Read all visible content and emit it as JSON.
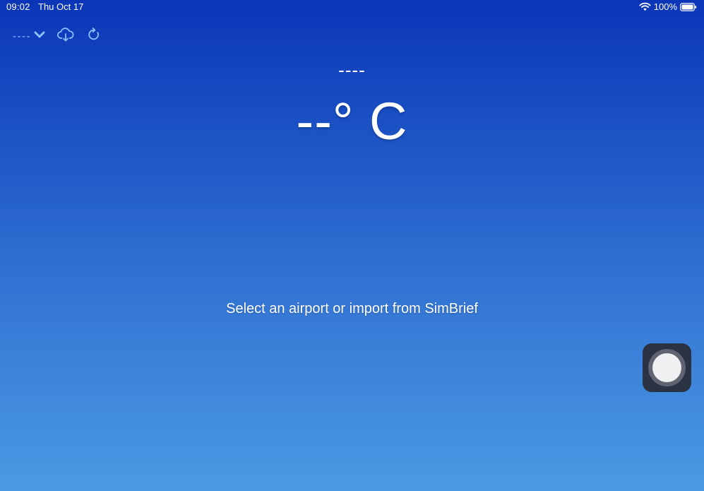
{
  "status_bar": {
    "time": "09:02",
    "date": "Thu Oct 17",
    "battery": "100%"
  },
  "toolbar": {
    "airport_code": "----",
    "icons": [
      "chevron-down-icon",
      "cloud-download-icon",
      "refresh-icon"
    ]
  },
  "weather": {
    "station": "----",
    "temperature": "--° C"
  },
  "message": "Select an airport or import from SimBrief",
  "colors": {
    "background_top": "#0a35b8",
    "background_bottom": "#4b99e3",
    "accent": "#8fc1ff"
  }
}
